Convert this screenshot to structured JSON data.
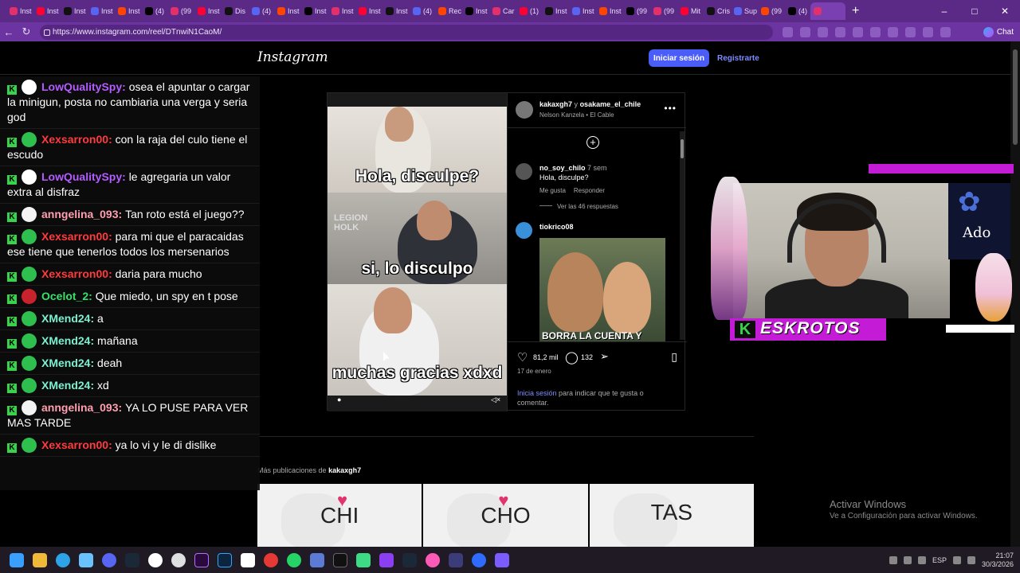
{
  "browser": {
    "tabs": [
      "Inst",
      "Inst",
      "Inst",
      "Inst",
      "Inst",
      "(4)",
      "(99",
      "Inst",
      "Dis",
      "(4)",
      "Inst",
      "Inst",
      "Inst",
      "Inst",
      "Inst",
      "(4)",
      "Rec",
      "Inst",
      "Car",
      "(1)",
      "Inst",
      "Inst",
      "Inst",
      "(99",
      "(99",
      "Mit",
      "Cris",
      "Sup",
      "(99",
      "(4)",
      ""
    ],
    "url": "https://www.instagram.com/reel/DTnwiN1CaoM/",
    "chat_label": "Chat"
  },
  "instagram": {
    "logo": "Instagram",
    "login_button": "Iniciar sesión",
    "register_link": "Registrarte",
    "post": {
      "captions": [
        "Hola, disculpe?",
        "si, lo disculpo",
        "muchas gracias xdxd"
      ],
      "watermark": "LEGION HOLK",
      "author_line_user": "kakaxgh7",
      "author_line_join": "y",
      "author_line_collab": "osakame_el_chile",
      "audio": "Nelson Kanzela • El Cable",
      "comments": [
        {
          "user": "no_soy_chilo",
          "age": "7 sem",
          "text": "Hola, disculpe?",
          "like": "Me gusta",
          "reply": "Responder",
          "replies": "Ver las 46 respuestas"
        },
        {
          "user": "tiokrico08",
          "image_text": "BORRA LA CUENTA Y"
        }
      ],
      "likes": "81,2 mil",
      "comment_count": "132",
      "date": "17 de enero",
      "login_prompt_link": "Inicia sesión",
      "login_prompt_rest": " para indicar que te gusta o comentar."
    },
    "more_posts_label": "Más publicaciones de",
    "more_posts_user": "kakaxgh7",
    "thumbs": [
      "CHI",
      "CHO",
      "TAS"
    ]
  },
  "chat": [
    {
      "user": "LowQualitySpy",
      "color": "#b45cff",
      "avatar": "#ffffff",
      "text": "osea el apuntar o cargar la minigun, posta no cambiaria una verga y seria god"
    },
    {
      "user": "Xexsarron00",
      "color": "#ff3b3b",
      "avatar": "#2fbf4f",
      "text": "con la raja del culo tiene el escudo"
    },
    {
      "user": "LowQualitySpy",
      "color": "#b45cff",
      "avatar": "#ffffff",
      "text": "le agregaria un valor extra al disfraz"
    },
    {
      "user": "anngelina_093",
      "color": "#ff9fb0",
      "avatar": "#f3f3f3",
      "text": "Tan roto está el juego??"
    },
    {
      "user": "Xexsarron00",
      "color": "#ff3b3b",
      "avatar": "#2fbf4f",
      "text": "para mi que el paracaidas ese tiene que tenerlos todos los mersenarios"
    },
    {
      "user": "Xexsarron00",
      "color": "#ff3b3b",
      "avatar": "#2fbf4f",
      "text": "daria para mucho"
    },
    {
      "user": "Ocelot_2",
      "color": "#38e06a",
      "avatar": "#c8232c",
      "text": "Que miedo, un spy en t pose"
    },
    {
      "user": "XMend24",
      "color": "#7cf0d0",
      "avatar": "#2fbf4f",
      "text": "a"
    },
    {
      "user": "XMend24",
      "color": "#7cf0d0",
      "avatar": "#2fbf4f",
      "text": "mañana"
    },
    {
      "user": "XMend24",
      "color": "#7cf0d0",
      "avatar": "#2fbf4f",
      "text": "deah"
    },
    {
      "user": "XMend24",
      "color": "#7cf0d0",
      "avatar": "#2fbf4f",
      "text": "xd"
    },
    {
      "user": "anngelina_093",
      "color": "#ff9fb0",
      "avatar": "#f3f3f3",
      "text": "YA LO PUSE PARA VER MAS TARDE"
    },
    {
      "user": "Xexsarron00",
      "color": "#ff3b3b",
      "avatar": "#2fbf4f",
      "text": "ya lo vi y le di dislike"
    }
  ],
  "stream": {
    "name": "ESKROTOS",
    "poster_text": "Ado"
  },
  "windows": {
    "activate_title": "Activar Windows",
    "activate_sub": "Ve a Configuración para activar Windows.",
    "lang": "ESP",
    "time": "21:07",
    "date": "30/3/2026"
  }
}
